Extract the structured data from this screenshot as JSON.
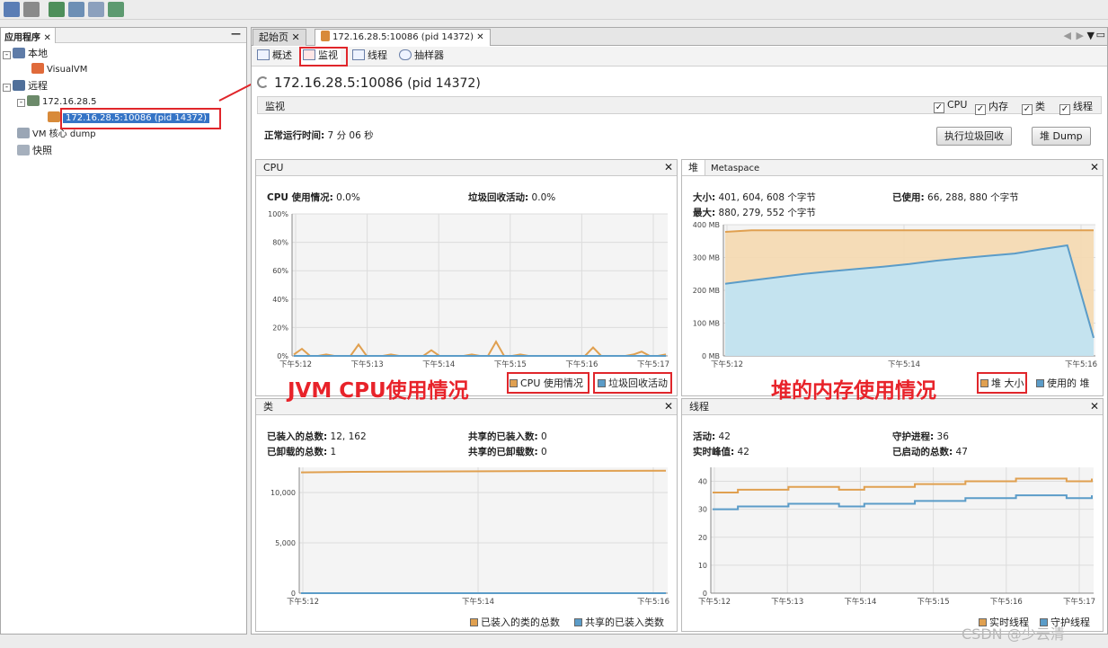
{
  "left_panel": {
    "title": "应用程序",
    "tree": [
      {
        "label": "本地"
      },
      {
        "label": "VisualVM"
      },
      {
        "label": "远程"
      },
      {
        "label": "172.16.28.5"
      },
      {
        "label": "172.16.28.5:10086 (pid 14372)"
      },
      {
        "label": "VM 核心 dump"
      },
      {
        "label": "快照"
      }
    ]
  },
  "main": {
    "tabs": [
      {
        "label": "起始页"
      },
      {
        "label": "172.16.28.5:10086 (pid 14372)"
      }
    ],
    "subtabs": [
      {
        "label": "概述"
      },
      {
        "label": "监视"
      },
      {
        "label": "线程"
      },
      {
        "label": "抽样器"
      }
    ],
    "title": "172.16.28.5:10086",
    "title_pid": "(pid 14372)",
    "section": "监视",
    "checkboxes": [
      "CPU",
      "内存",
      "类",
      "线程"
    ],
    "uptime_label": "正常运行时间:",
    "uptime_value": "7 分 06 秒",
    "gc_button": "执行垃圾回收",
    "heapdump_button": "堆 Dump"
  },
  "cpu_panel": {
    "title": "CPU",
    "usage_label": "CPU 使用情况:",
    "usage_value": "0.0%",
    "gc_label": "垃圾回收活动:",
    "gc_value": "0.0%",
    "legend": [
      "CPU 使用情况",
      "垃圾回收活动"
    ]
  },
  "heap_panel": {
    "tab1": "堆",
    "tab2": "Metaspace",
    "size_label": "大小:",
    "size_value": "401, 604, 608 个字节",
    "max_label": "最大:",
    "max_value": "880, 279, 552 个字节",
    "used_label": "已使用:",
    "used_value": "66, 288, 880 个字节",
    "legend": [
      "堆 大小",
      "使用的 堆"
    ]
  },
  "class_panel": {
    "title": "类",
    "loaded_label": "已装入的总数:",
    "loaded_value": "12, 162",
    "unloaded_label": "已卸载的总数:",
    "unloaded_value": "1",
    "shared_loaded_label": "共享的已装入数:",
    "shared_loaded_value": "0",
    "shared_unloaded_label": "共享的已卸载数:",
    "shared_unloaded_value": "0",
    "legend": [
      "已装入的类的总数",
      "共享的已装入类数"
    ]
  },
  "thread_panel": {
    "title": "线程",
    "live_label": "活动:",
    "live_value": "42",
    "peak_label": "实时峰值:",
    "peak_value": "42",
    "daemon_label": "守护进程:",
    "daemon_value": "36",
    "started_label": "已启动的总数:",
    "started_value": "47",
    "legend": [
      "实时线程",
      "守护线程"
    ]
  },
  "annotations": {
    "cpu": "JVM CPU使用情况",
    "heap": "堆的内存使用情况"
  },
  "watermark": "CSDN @少云清",
  "colors": {
    "orange": "#e0a050",
    "blue": "#5b9cc8",
    "heap_fill": "#f5d9b0",
    "used_fill": "#bfe3f5",
    "selection": "#3574c6",
    "red": "#e0262b"
  },
  "chart_data": [
    {
      "type": "line",
      "name": "CPU",
      "x_ticks": [
        "下午5:12",
        "下午5:13",
        "下午5:14",
        "下午5:15",
        "下午5:16",
        "下午5:17"
      ],
      "y_ticks": [
        "0%",
        "20%",
        "40%",
        "60%",
        "80%",
        "100%"
      ],
      "ylim": [
        0,
        100
      ],
      "series": [
        {
          "name": "CPU 使用情况",
          "values": [
            1,
            5,
            0,
            0,
            1,
            0,
            0,
            0,
            8,
            0,
            0,
            0,
            1,
            0,
            0,
            0,
            0,
            4,
            0,
            0,
            0,
            0,
            1,
            0,
            0,
            10,
            0,
            0,
            1,
            0,
            0,
            0,
            0,
            0,
            0,
            0,
            0,
            6,
            0,
            0,
            0,
            0,
            1,
            3,
            0,
            0,
            1
          ]
        },
        {
          "name": "垃圾回收活动",
          "values": [
            0,
            0,
            0,
            0,
            0,
            0,
            0,
            0,
            0,
            0,
            0,
            0,
            0,
            0,
            0,
            0,
            0,
            0,
            0,
            0,
            0,
            0,
            0,
            0,
            0,
            0,
            0,
            0,
            0,
            0,
            0,
            0,
            0,
            0,
            0,
            0,
            0,
            0,
            0,
            0,
            0,
            0,
            0,
            0,
            0,
            0,
            0
          ]
        }
      ]
    },
    {
      "type": "area",
      "name": "堆",
      "x_ticks": [
        "下午5:12",
        "下午5:14",
        "下午5:16"
      ],
      "y_ticks": [
        "0 MB",
        "100 MB",
        "200 MB",
        "300 MB",
        "400 MB"
      ],
      "ylim": [
        0,
        400
      ],
      "series": [
        {
          "name": "堆 大小",
          "values": [
            378,
            383,
            383,
            383,
            383,
            383,
            383,
            383,
            383,
            383,
            383,
            383,
            383,
            383,
            383
          ]
        },
        {
          "name": "使用的 堆",
          "values": [
            220,
            230,
            240,
            250,
            258,
            265,
            272,
            280,
            290,
            298,
            305,
            312,
            325,
            337,
            55
          ]
        }
      ]
    },
    {
      "type": "line",
      "name": "类",
      "x_ticks": [
        "下午5:12",
        "下午5:14",
        "下午5:16"
      ],
      "y_ticks": [
        "0",
        "5,000",
        "10,000"
      ],
      "ylim": [
        0,
        12500
      ],
      "series": [
        {
          "name": "已装入的类的总数",
          "values": [
            12000,
            12050,
            12080,
            12100,
            12120,
            12140,
            12150,
            12162
          ]
        },
        {
          "name": "共享的已装入类数",
          "values": [
            0,
            0,
            0,
            0,
            0,
            0,
            0,
            0
          ]
        }
      ]
    },
    {
      "type": "line",
      "name": "线程",
      "x_ticks": [
        "下午5:12",
        "下午5:13",
        "下午5:14",
        "下午5:15",
        "下午5:16",
        "下午5:17"
      ],
      "y_ticks": [
        "0",
        "10",
        "20",
        "30",
        "40"
      ],
      "ylim": [
        0,
        45
      ],
      "series": [
        {
          "name": "实时线程",
          "values": [
            36,
            37,
            37,
            38,
            38,
            37,
            38,
            38,
            39,
            39,
            40,
            40,
            41,
            41,
            40,
            41
          ]
        },
        {
          "name": "守护线程",
          "values": [
            30,
            31,
            31,
            32,
            32,
            31,
            32,
            32,
            33,
            33,
            34,
            34,
            35,
            35,
            34,
            35
          ]
        }
      ]
    }
  ]
}
